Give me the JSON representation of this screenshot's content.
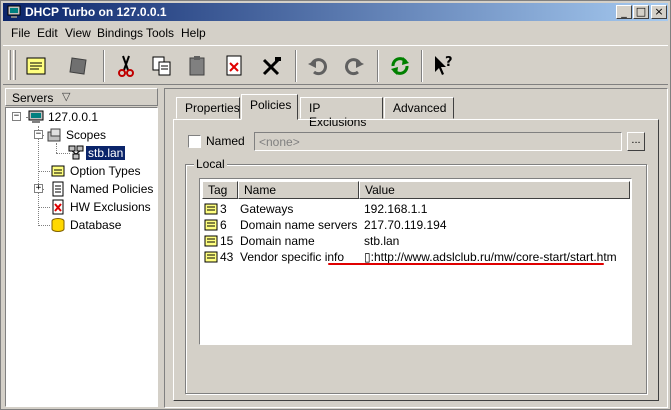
{
  "window": {
    "title": "DHCP Turbo on 127.0.0.1"
  },
  "menu": [
    "File",
    "Edit",
    "View",
    "Bindings",
    "Tools",
    "Help"
  ],
  "toolbar": [
    "properties-icon",
    "cube-icon",
    "cut-icon",
    "copy-icon",
    "paste-icon",
    "delete-icon",
    "tools-icon",
    "undo-icon",
    "redo-icon",
    "refresh-icon",
    "help-pointer-icon"
  ],
  "left": {
    "header": "Servers",
    "tree": {
      "server": "127.0.0.1",
      "scopes": "Scopes",
      "scope_item": "stb.lan",
      "option_types": "Option Types",
      "named_policies": "Named Policies",
      "hw_exclusions": "HW Exclusions",
      "database": "Database"
    }
  },
  "tabs": [
    "Properties",
    "Policies",
    "IP Exclusions",
    "Advanced"
  ],
  "active_tab": "Policies",
  "policies": {
    "named_label": "Named",
    "named_value": "<none>",
    "dots_label": "...",
    "group_label": "Local",
    "columns": [
      "Tag",
      "Name",
      "Value"
    ],
    "rows": [
      {
        "tag": "3",
        "name": "Gateways",
        "value": "192.168.1.1"
      },
      {
        "tag": "6",
        "name": "Domain name servers",
        "value": "217.70.119.194"
      },
      {
        "tag": "15",
        "name": "Domain name",
        "value": "stb.lan"
      },
      {
        "tag": "43",
        "name": "Vendor specific info",
        "value": "▯:http://www.adslclub.ru/mw/core-start/start.htm"
      }
    ]
  },
  "colors": {
    "title_start": "#0a246a",
    "title_end": "#a6caf0",
    "selection": "#0a246a",
    "underline": "#e00000"
  }
}
